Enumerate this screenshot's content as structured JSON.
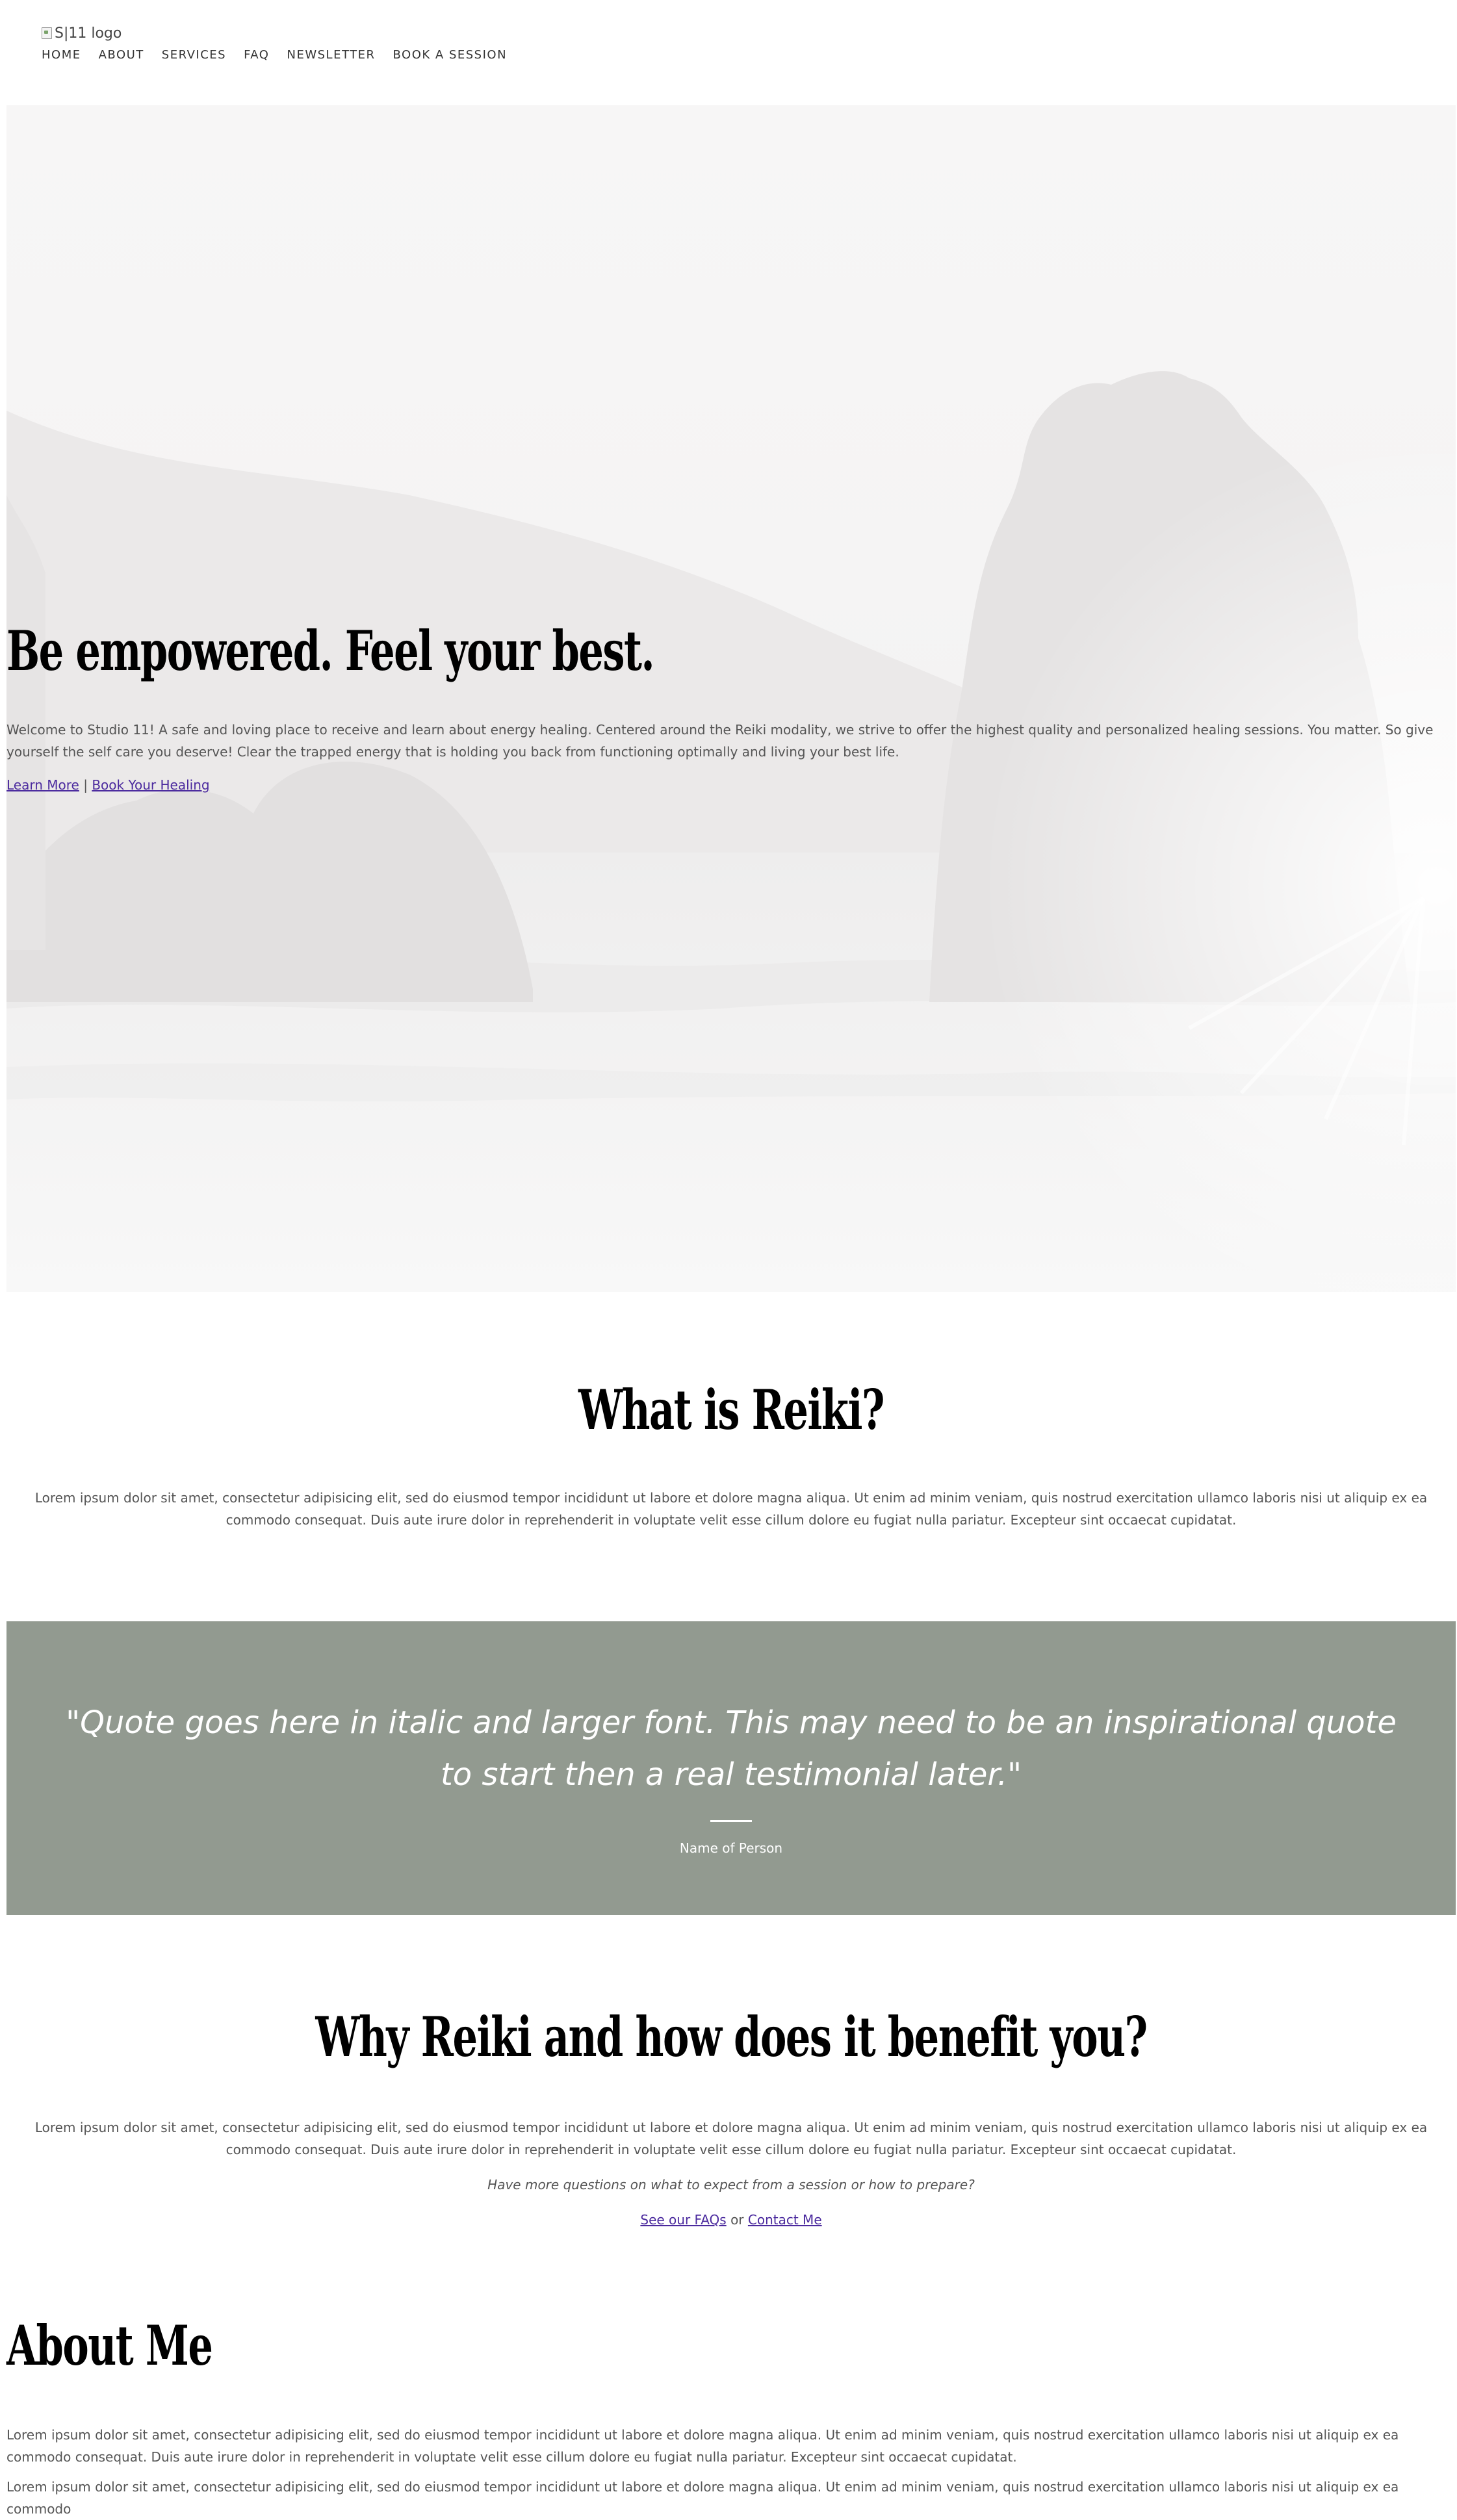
{
  "header": {
    "logo_alt": "S|11 logo",
    "nav": [
      "HOME",
      "ABOUT",
      "SERVICES",
      "FAQ",
      "NEWSLETTER",
      "BOOK A SESSION"
    ]
  },
  "hero": {
    "title": "Be empowered. Feel your best.",
    "body": "Welcome to Studio 11! A safe and loving place to receive and learn about energy healing. Centered around the Reiki modality, we strive to offer the highest quality and personalized healing sessions. You matter. So give yourself the self care you deserve! Clear the trapped energy that is holding you back from functioning optimally and living your best life.",
    "learn_more": "Learn More",
    "separator": "|",
    "book_healing": "Book Your Healing"
  },
  "what_is_reiki": {
    "title": "What is Reiki?",
    "body": "Lorem ipsum dolor sit amet, consectetur adipisicing elit, sed do eiusmod tempor incididunt ut labore et dolore magna aliqua. Ut enim ad minim veniam, quis nostrud exercitation ullamco laboris nisi ut aliquip ex ea commodo consequat. Duis aute irure dolor in reprehenderit in voluptate velit esse cillum dolore eu fugiat nulla pariatur. Excepteur sint occaecat cupidatat."
  },
  "quote": {
    "text": "\"Quote goes here in italic and larger font. This may need to be an inspirational quote to start then a real testimonial later.\"",
    "name": "Name of Person",
    "band_color": "#929a90"
  },
  "why_reiki": {
    "title": "Why Reiki and how does it benefit you?",
    "body": "Lorem ipsum dolor sit amet, consectetur adipisicing elit, sed do eiusmod tempor incididunt ut labore et dolore magna aliqua. Ut enim ad minim veniam, quis nostrud exercitation ullamco laboris nisi ut aliquip ex ea commodo consequat. Duis aute irure dolor in reprehenderit in voluptate velit esse cillum dolore eu fugiat nulla pariatur. Excepteur sint occaecat cupidatat.",
    "questions": "Have more questions on what to expect from a session or how to prepare?",
    "faq_link": "See our FAQs",
    "or_text": "or",
    "contact_link": "Contact Me"
  },
  "about": {
    "title": "About Me",
    "paragraphs": [
      "Lorem ipsum dolor sit amet, consectetur adipisicing elit, sed do eiusmod tempor incididunt ut labore et dolore magna aliqua. Ut enim ad minim veniam, quis nostrud exercitation ullamco laboris nisi ut aliquip ex ea commodo consequat. Duis aute irure dolor in reprehenderit in voluptate velit esse cillum dolore eu fugiat nulla pariatur. Excepteur sint occaecat cupidatat.",
      "Lorem ipsum dolor sit amet, consectetur adipisicing elit, sed do eiusmod tempor incididunt ut labore et dolore magna aliqua. Ut enim ad minim veniam, quis nostrud exercitation ullamco laboris nisi ut aliquip ex ea commodo"
    ]
  },
  "colors": {
    "link": "#4b2a9e",
    "text": "#555555",
    "heading": "#000000"
  }
}
